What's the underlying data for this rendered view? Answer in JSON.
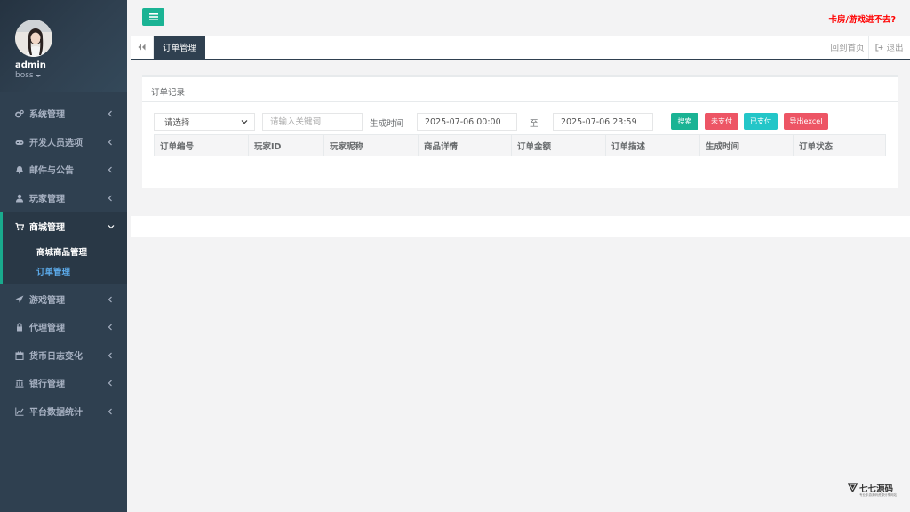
{
  "user": {
    "name": "admin",
    "role": "boss"
  },
  "sidebar": {
    "items": [
      {
        "label": "系统管理",
        "icon": "gears-icon"
      },
      {
        "label": "开发人员选项",
        "icon": "gamepad-icon"
      },
      {
        "label": "邮件与公告",
        "icon": "bell-icon"
      },
      {
        "label": "玩家管理",
        "icon": "user-icon"
      },
      {
        "label": "商城管理",
        "icon": "cart-icon",
        "expanded": true,
        "children": [
          {
            "label": "商城商品管理"
          },
          {
            "label": "订单管理",
            "current": true
          }
        ]
      },
      {
        "label": "游戏管理",
        "icon": "rocket-icon"
      },
      {
        "label": "代理管理",
        "icon": "lock-icon"
      },
      {
        "label": "货币日志变化",
        "icon": "calendar-icon"
      },
      {
        "label": "银行管理",
        "icon": "bank-icon"
      },
      {
        "label": "平台数据统计",
        "icon": "line-chart-icon"
      }
    ]
  },
  "topbar": {
    "warning": "卡房/游戏进不去?"
  },
  "tabs": {
    "active": "订单管理",
    "home": "回到首页",
    "logout": "退出"
  },
  "panel": {
    "title": "订单记录",
    "filters": {
      "select_value": "请选择",
      "keyword_placeholder": "请输入关键词",
      "time_label": "生成时间",
      "start": "2025-07-06 00:00",
      "to_label": "至",
      "end": "2025-07-06 23:59"
    },
    "buttons": {
      "search": "搜索",
      "unpaid": "未支付",
      "paid": "已支付",
      "export": "导出excel"
    },
    "columns": [
      "订单编号",
      "玩家ID",
      "玩家昵称",
      "商品详情",
      "订单金额",
      "订单描述",
      "生成时间",
      "订单状态"
    ]
  },
  "watermark": {
    "text": "七七源码",
    "sub": "专业手游源码资源分享网站"
  },
  "colors": {
    "sidebar": "#2f4050",
    "primary": "#1ab394",
    "danger": "#ed5565",
    "info": "#23c6c8",
    "warning_text": "#ff0000"
  }
}
